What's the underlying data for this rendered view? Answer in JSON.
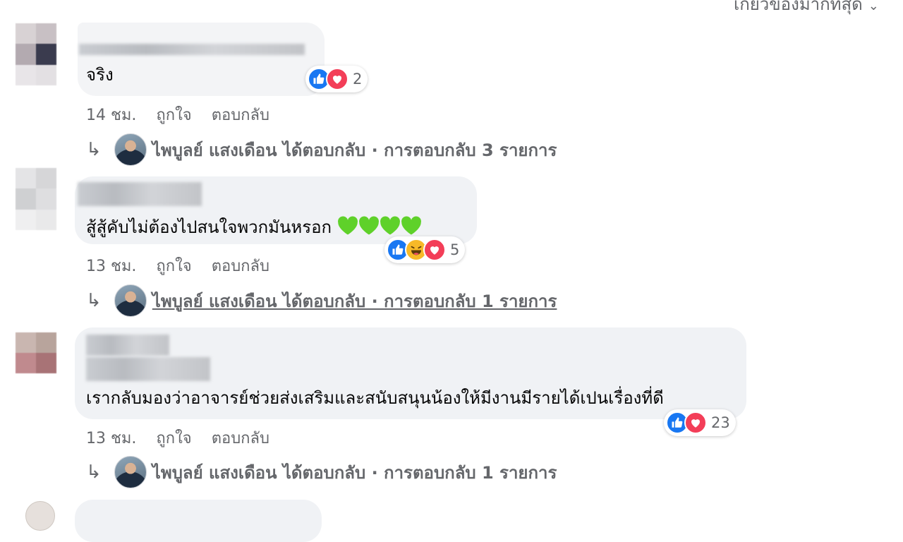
{
  "sort_hint": {
    "label": "เกี่ยวข้องมากที่สุด"
  },
  "comments": [
    {
      "text": "จริง",
      "reactions": {
        "count": "2"
      },
      "meta": {
        "time": "14 ชม.",
        "like": "ถูกใจ",
        "reply": "ตอบกลับ"
      },
      "reply_summary": {
        "text": "ไพบูลย์ แสงเดือน ได้ตอบกลับ · การตอบกลับ 3 รายการ"
      }
    },
    {
      "text": "สู้สู้คับไม่ต้องไปสนใจพวกมันหรอก",
      "reactions": {
        "count": "5"
      },
      "meta": {
        "time": "13 ชม.",
        "like": "ถูกใจ",
        "reply": "ตอบกลับ"
      },
      "reply_summary": {
        "text": "ไพบูลย์ แสงเดือน ได้ตอบกลับ · การตอบกลับ 1 รายการ"
      }
    },
    {
      "text": "เรากลับมองว่าอาจารย์ช่วยส่งเสริมและสนับสนุนน้องให้มีงานมีรายได้เปนเรื่องที่ดี",
      "reactions": {
        "count": "23"
      },
      "meta": {
        "time": "13 ชม.",
        "like": "ถูกใจ",
        "reply": "ตอบกลับ"
      },
      "reply_summary": {
        "text": "ไพบูลย์ แสงเดือน ได้ตอบกลับ · การตอบกลับ 1 รายการ"
      }
    }
  ],
  "colors": {
    "like": "#1877f2",
    "love": "#f33e58",
    "haha": "#f7b928",
    "green_heart": "#5fd12a",
    "bubble": "#f0f2f5",
    "meta": "#65676b"
  },
  "icons": [
    "like-reaction-icon",
    "love-reaction-icon",
    "haha-reaction-icon",
    "green-heart-emoji",
    "reply-arrow-icon",
    "chevron-down-icon"
  ]
}
